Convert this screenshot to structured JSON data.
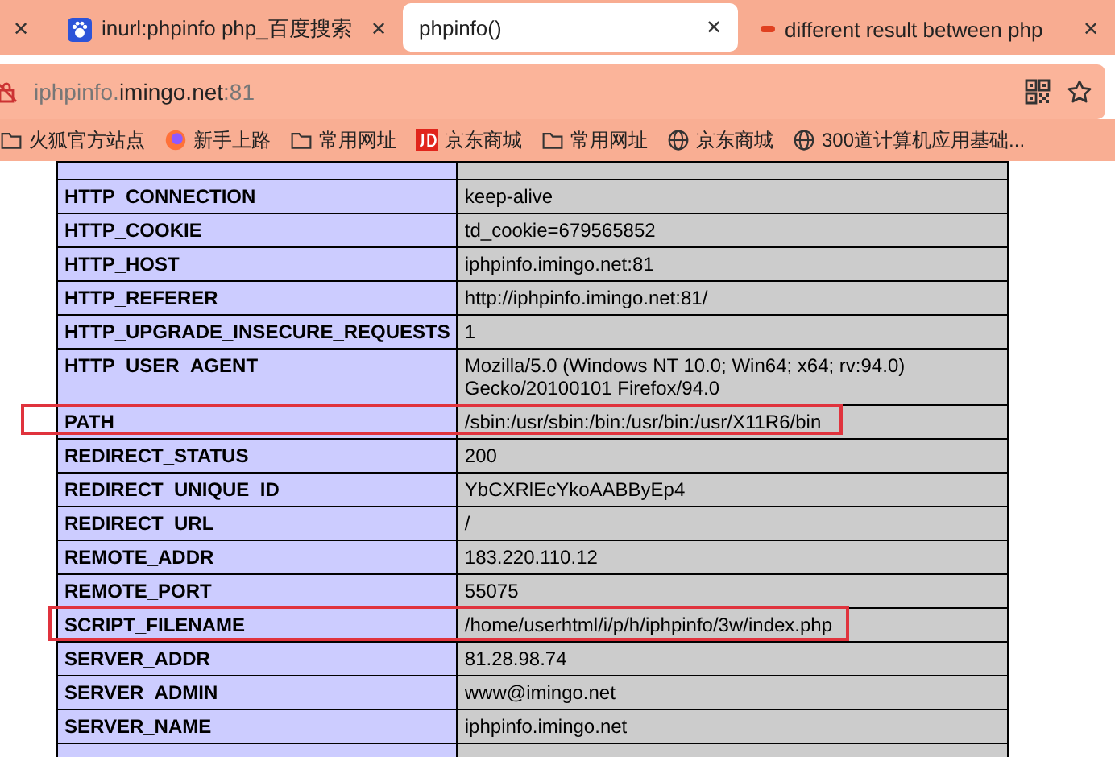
{
  "tabs": [
    {
      "kind": "partial",
      "close": "✕",
      "selected": false
    },
    {
      "kind": "baidu",
      "title": "inurl:phpinfo php_百度搜索",
      "close": "✕",
      "selected": false
    },
    {
      "kind": "plain",
      "title": "phpinfo()",
      "close": "✕",
      "selected": true
    },
    {
      "kind": "dot",
      "title": "different result between php",
      "close": "✕",
      "selected": false
    }
  ],
  "address_bar": {
    "host_sub": "iphpinfo.",
    "host_main": "imingo.net",
    "port": ":81"
  },
  "bookmarks": [
    {
      "kind": "folder",
      "label": "火狐官方站点"
    },
    {
      "kind": "firefox",
      "label": "新手上路"
    },
    {
      "kind": "folder",
      "label": "常用网址"
    },
    {
      "kind": "jd",
      "label": "京东商城"
    },
    {
      "kind": "folder",
      "label": "常用网址"
    },
    {
      "kind": "globe",
      "label": "京东商城"
    },
    {
      "kind": "globe",
      "label": "300道计算机应用基础..."
    }
  ],
  "table": {
    "rows": [
      {
        "highlighted": false,
        "kind": "partial"
      },
      {
        "key": "HTTP_CONNECTION",
        "value": "keep-alive",
        "highlighted": false,
        "kind": "full"
      },
      {
        "key": "HTTP_COOKIE",
        "value": "td_cookie=679565852",
        "highlighted": false,
        "kind": "full"
      },
      {
        "key": "HTTP_HOST",
        "value": "iphpinfo.imingo.net:81",
        "highlighted": false,
        "kind": "full"
      },
      {
        "key": "HTTP_REFERER",
        "value": "http://iphpinfo.imingo.net:81/",
        "highlighted": false,
        "kind": "full"
      },
      {
        "key": "HTTP_UPGRADE_INSECURE_REQUESTS",
        "value": "1",
        "highlighted": false,
        "kind": "full"
      },
      {
        "key": "HTTP_USER_AGENT",
        "value": "Mozilla/5.0 (Windows NT 10.0; Win64; x64; rv:94.0) Gecko/20100101 Firefox/94.0",
        "highlighted": false,
        "kind": "full"
      },
      {
        "key": "PATH",
        "value": "/sbin:/usr/sbin:/bin:/usr/bin:/usr/X11R6/bin",
        "highlighted": true,
        "kind": "full"
      },
      {
        "key": "REDIRECT_STATUS",
        "value": "200",
        "highlighted": false,
        "kind": "full"
      },
      {
        "key": "REDIRECT_UNIQUE_ID",
        "value": "YbCXRlEcYkoAABByEp4",
        "highlighted": false,
        "kind": "full"
      },
      {
        "key": "REDIRECT_URL",
        "value": "/",
        "highlighted": false,
        "kind": "full"
      },
      {
        "key": "REMOTE_ADDR",
        "value": "183.220.110.12",
        "highlighted": false,
        "kind": "full"
      },
      {
        "key": "REMOTE_PORT",
        "value": "55075",
        "highlighted": false,
        "kind": "full"
      },
      {
        "key": "SCRIPT_FILENAME",
        "value": "/home/userhtml/i/p/h/iphpinfo/3w/index.php",
        "highlighted": true,
        "kind": "full"
      },
      {
        "key": "SERVER_ADDR",
        "value": "81.28.98.74",
        "highlighted": false,
        "kind": "full"
      },
      {
        "key": "SERVER_ADMIN",
        "value": "www@imingo.net",
        "highlighted": false,
        "kind": "full"
      },
      {
        "key": "SERVER_NAME",
        "value": "iphpinfo.imingo.net",
        "highlighted": false,
        "kind": "full"
      },
      {
        "highlighted": false,
        "kind": "partial"
      }
    ]
  }
}
